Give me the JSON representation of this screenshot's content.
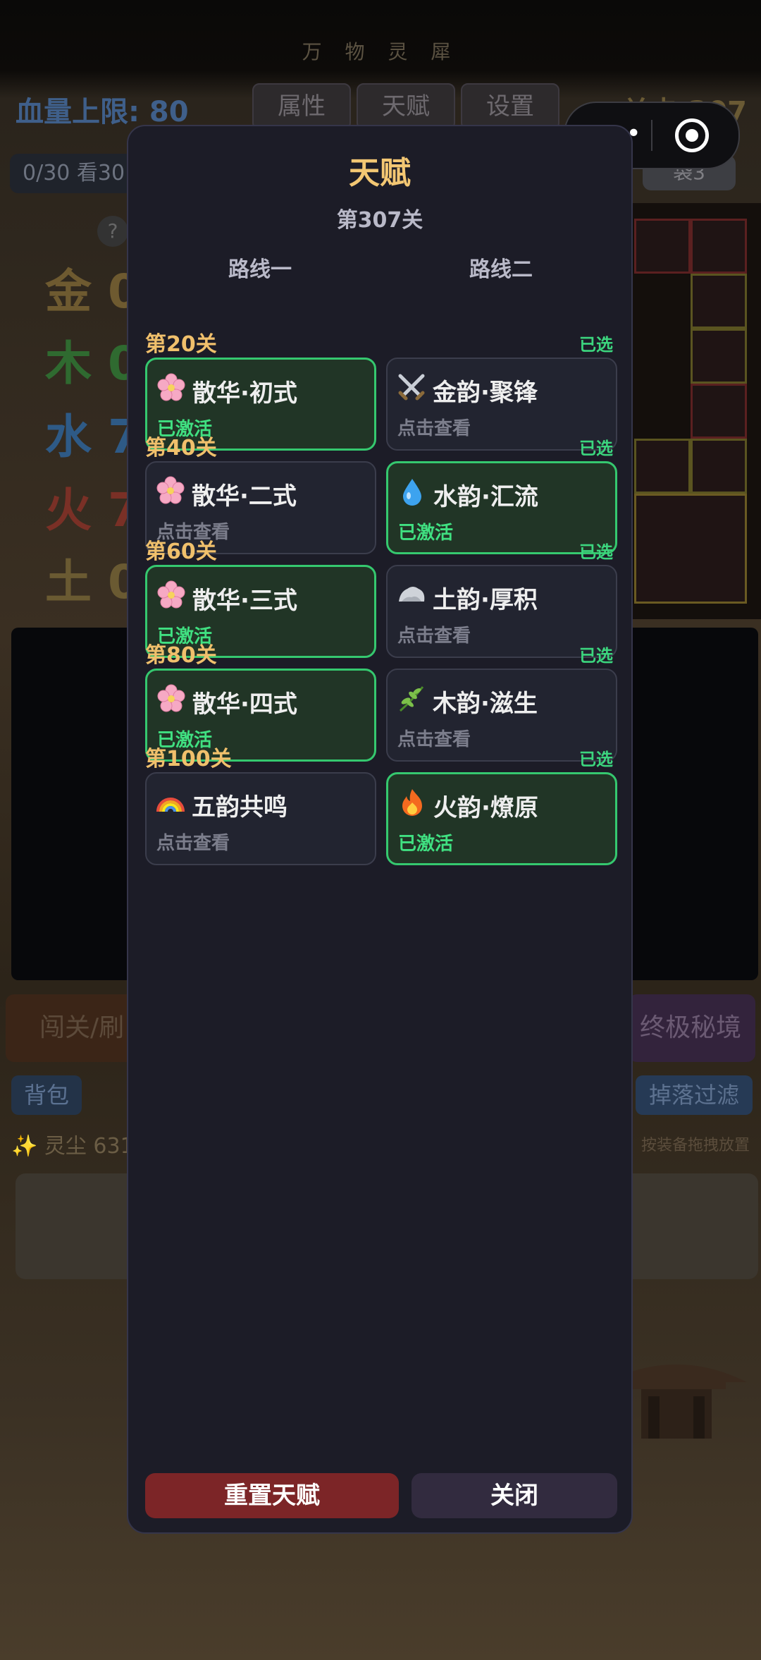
{
  "background": {
    "game_title": "万 物 灵 犀",
    "hp_text": "血量上限: 80",
    "stage_text": "关卡 307",
    "top_tabs": [
      "属性",
      "天赋",
      "设置"
    ],
    "ad_strip_text": "0/30 看30",
    "bag3_label": "袋3",
    "help_mark": "?",
    "elements": [
      {
        "char": "金",
        "text": "金 0",
        "color": "#6e5a30"
      },
      {
        "char": "木",
        "text": "木 0",
        "color": "#2f6a30"
      },
      {
        "char": "水",
        "text": "水 7",
        "color": "#2e5a86"
      },
      {
        "char": "火",
        "text": "火 7",
        "color": "#7a3026"
      },
      {
        "char": "土",
        "text": "土 0",
        "color": "#6a5a32"
      }
    ],
    "bottom_left_button": "闯关/刷",
    "bottom_right_button": "终极秘境",
    "bag_tab": "背包",
    "filter_tab": "掉落过滤",
    "dust_text": "✨ 灵尘 631",
    "drag_hint": "按装备拖拽放置"
  },
  "capsule": {
    "more_label": "•••"
  },
  "modal": {
    "title": "天赋",
    "subtitle": "第307关",
    "route_one": "路线一",
    "route_two": "路线二",
    "tiers": [
      {
        "label": "第20关",
        "chosen": "已选",
        "left": {
          "name": "散华·初式",
          "status": "已激活",
          "active": true,
          "icon": "cherry-blossom-icon"
        },
        "right": {
          "name": "金韵·聚锋",
          "status": "点击查看",
          "active": false,
          "icon": "crossed-swords-icon"
        }
      },
      {
        "label": "第40关",
        "chosen": "已选",
        "left": {
          "name": "散华·二式",
          "status": "点击查看",
          "active": false,
          "icon": "cherry-blossom-icon"
        },
        "right": {
          "name": "水韵·汇流",
          "status": "已激活",
          "active": true,
          "icon": "droplet-icon"
        }
      },
      {
        "label": "第60关",
        "chosen": "已选",
        "left": {
          "name": "散华·三式",
          "status": "已激活",
          "active": true,
          "icon": "cherry-blossom-icon"
        },
        "right": {
          "name": "土韵·厚积",
          "status": "点击查看",
          "active": false,
          "icon": "rock-icon"
        }
      },
      {
        "label": "第80关",
        "chosen": "已选",
        "left": {
          "name": "散华·四式",
          "status": "已激活",
          "active": true,
          "icon": "cherry-blossom-icon"
        },
        "right": {
          "name": "木韵·滋生",
          "status": "点击查看",
          "active": false,
          "icon": "herb-icon"
        }
      },
      {
        "label": "第100关",
        "chosen": "已选",
        "left": {
          "name": "五韵共鸣",
          "status": "点击查看",
          "active": false,
          "icon": "rainbow-icon"
        },
        "right": {
          "name": "火韵·燎原",
          "status": "已激活",
          "active": true,
          "icon": "fire-icon"
        }
      }
    ],
    "reset_button": "重置天赋",
    "close_button": "关闭"
  },
  "colors": {
    "accent_gold": "#f3c773",
    "active_green": "#35c86f",
    "reset_red": "#7c2527"
  }
}
